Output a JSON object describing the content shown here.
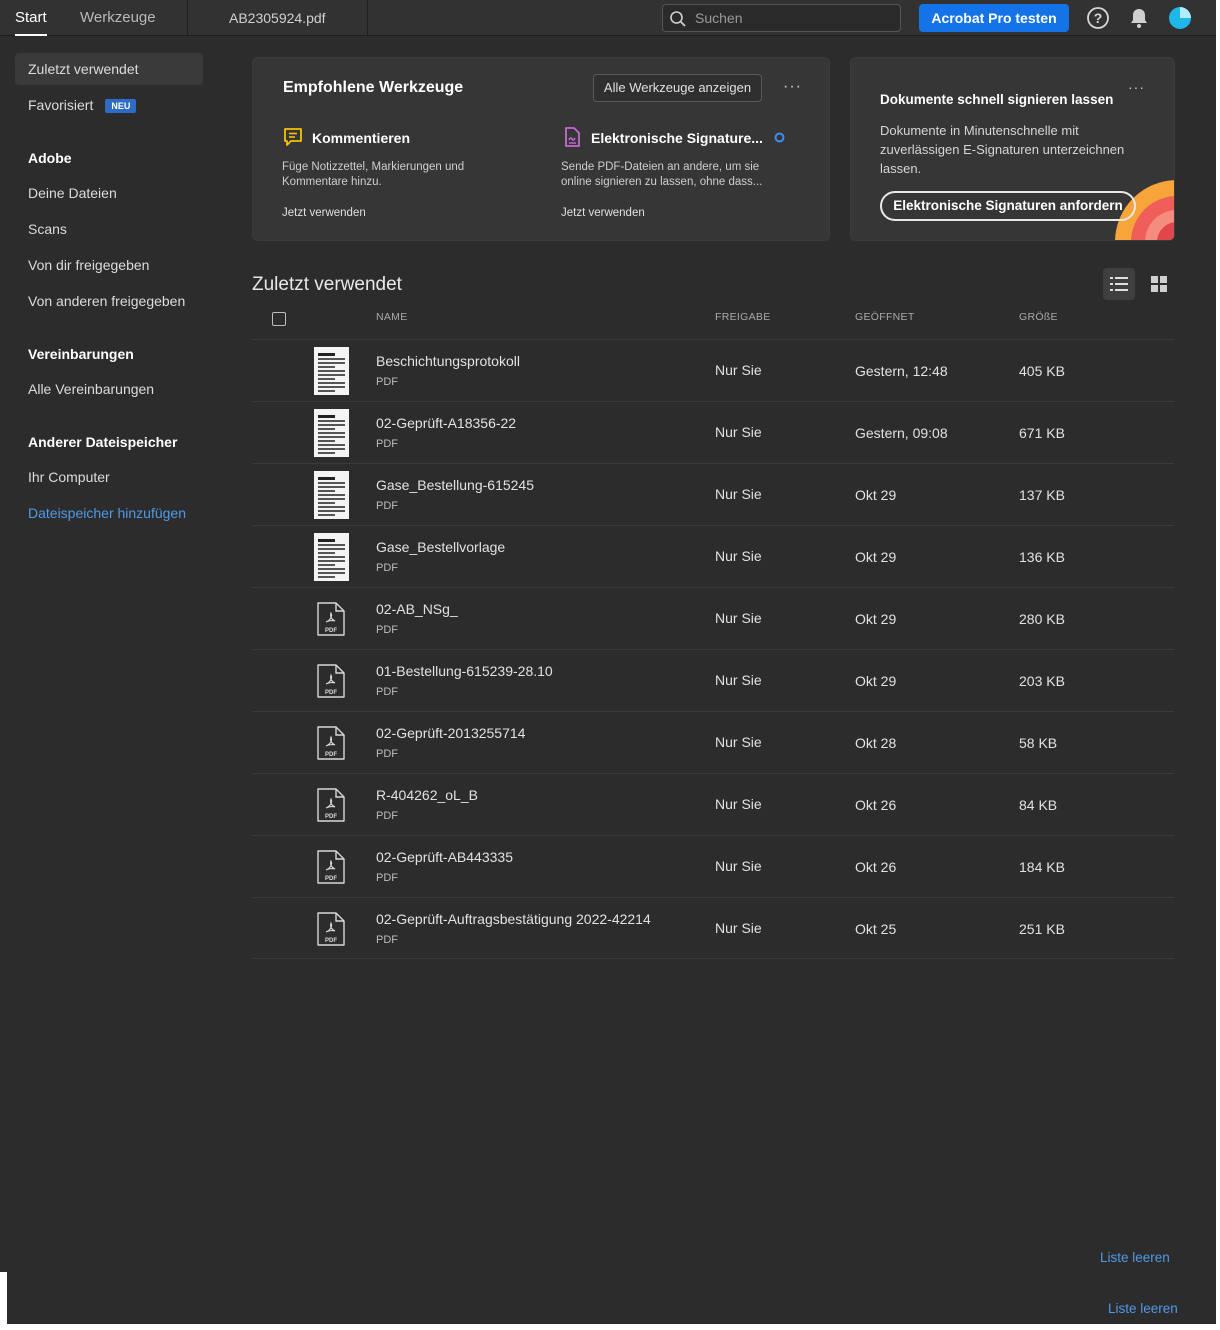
{
  "topbar": {
    "tabs": [
      "Start",
      "Werkzeuge",
      "AB2305924.pdf"
    ],
    "search_placeholder": "Suchen",
    "cta": "Acrobat Pro testen",
    "help_icon": "help-icon",
    "bell_icon": "bell-icon",
    "avatar_icon": "avatar-icon"
  },
  "sidebar": {
    "recent": "Zuletzt verwendet",
    "favorites": "Favorisiert",
    "favorites_badge": "NEU",
    "adobe_head": "Adobe",
    "adobe_items": [
      "Deine Dateien",
      "Scans",
      "Von dir freigegeben",
      "Von anderen freigegeben"
    ],
    "agreements_head": "Vereinbarungen",
    "agreements_items": [
      "Alle Vereinbarungen"
    ],
    "storage_head": "Anderer Dateispeicher",
    "storage_items": [
      "Ihr Computer"
    ],
    "add_storage": "Dateispeicher hinzufügen"
  },
  "tools_card": {
    "title": "Empfohlene Werkzeuge",
    "all_tools": "Alle Werkzeuge anzeigen",
    "more": "···",
    "tools": [
      {
        "name": "Kommentieren",
        "desc": "Füge Notizzettel, Markierungen und Kommentare hinzu.",
        "link": "Jetzt verwenden",
        "icon": "comment-icon",
        "color": "#f4c400"
      },
      {
        "name": "Elektronische Signature...",
        "desc": "Sende PDF-Dateien an andere, um sie online signieren zu lassen, ohne dass...",
        "link": "Jetzt verwenden",
        "icon": "e-signature-icon",
        "color": "#c66ad6"
      }
    ]
  },
  "sign_card": {
    "title": "Dokumente schnell signieren lassen",
    "more": "···",
    "text": "Dokumente in Minutenschnelle mit zuverlässigen E-Signaturen unterzeichnen lassen.",
    "button": "Elektronische Signaturen anfordern"
  },
  "list": {
    "title": "Zuletzt verwendet",
    "columns": [
      "NAME",
      "FREIGABE",
      "GEÖFFNET",
      "GRÖßE"
    ],
    "files": [
      {
        "name": "Beschichtungsprotokoll",
        "type": "PDF",
        "share": "Nur Sie",
        "opened": "Gestern, 12:48",
        "size": "405 KB",
        "thumb": "doc"
      },
      {
        "name": "02-Geprüft-A18356-22",
        "type": "PDF",
        "share": "Nur Sie",
        "opened": "Gestern, 09:08",
        "size": "671 KB",
        "thumb": "doc"
      },
      {
        "name": "Gase_Bestellung-615245",
        "type": "PDF",
        "share": "Nur Sie",
        "opened": "Okt 29",
        "size": "137 KB",
        "thumb": "doc"
      },
      {
        "name": "Gase_Bestellvorlage",
        "type": "PDF",
        "share": "Nur Sie",
        "opened": "Okt 29",
        "size": "136 KB",
        "thumb": "doc"
      },
      {
        "name": "02-AB_NSg_",
        "type": "PDF",
        "share": "Nur Sie",
        "opened": "Okt 29",
        "size": "280 KB",
        "thumb": "pdf"
      },
      {
        "name": "01-Bestellung-615239-28.10",
        "type": "PDF",
        "share": "Nur Sie",
        "opened": "Okt 29",
        "size": "203 KB",
        "thumb": "pdf"
      },
      {
        "name": "02-Geprüft-2013255714",
        "type": "PDF",
        "share": "Nur Sie",
        "opened": "Okt 28",
        "size": "58 KB",
        "thumb": "pdf"
      },
      {
        "name": "R-404262_oL_B",
        "type": "PDF",
        "share": "Nur Sie",
        "opened": "Okt 26",
        "size": "84 KB",
        "thumb": "pdf"
      },
      {
        "name": "02-Geprüft-AB443335",
        "type": "PDF",
        "share": "Nur Sie",
        "opened": "Okt 26",
        "size": "184 KB",
        "thumb": "pdf"
      },
      {
        "name": "02-Geprüft-Auftragsbestätigung 2022-42214",
        "type": "PDF",
        "share": "Nur Sie",
        "opened": "Okt 25",
        "size": "251 KB",
        "thumb": "pdf"
      }
    ],
    "pdf_badge": "PDF",
    "clear": "Liste leeren",
    "clear_outer": "Liste leeren"
  },
  "colors": {
    "accent": "#1473e6",
    "link": "#4f9ae8",
    "bg": "#2c2c2c",
    "card": "#363636"
  }
}
